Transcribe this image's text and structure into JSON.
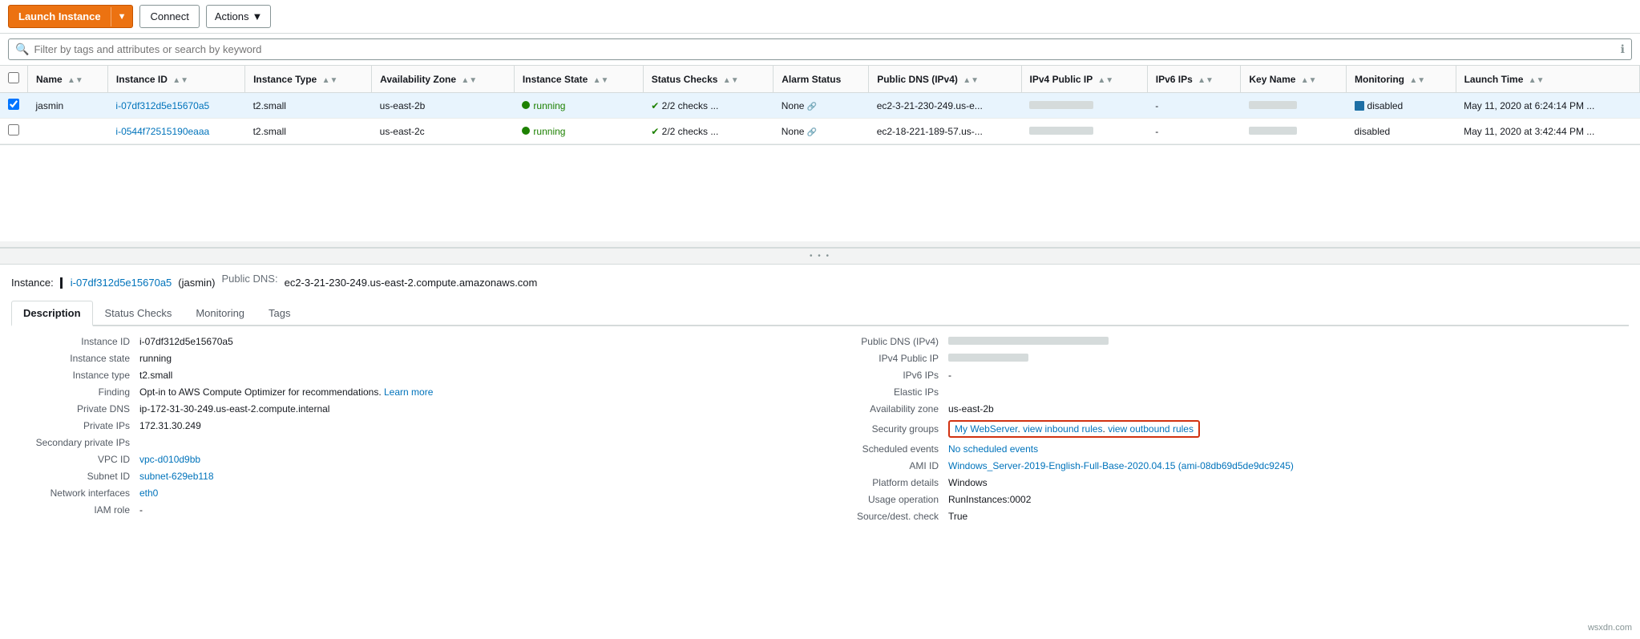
{
  "toolbar": {
    "launch_label": "Launch Instance",
    "connect_label": "Connect",
    "actions_label": "Actions"
  },
  "search": {
    "placeholder": "Filter by tags and attributes or search by keyword"
  },
  "table": {
    "columns": [
      {
        "key": "checkbox",
        "label": ""
      },
      {
        "key": "name",
        "label": "Name"
      },
      {
        "key": "instance_id",
        "label": "Instance ID"
      },
      {
        "key": "instance_type",
        "label": "Instance Type"
      },
      {
        "key": "availability_zone",
        "label": "Availability Zone"
      },
      {
        "key": "instance_state",
        "label": "Instance State"
      },
      {
        "key": "status_checks",
        "label": "Status Checks"
      },
      {
        "key": "alarm_status",
        "label": "Alarm Status"
      },
      {
        "key": "public_dns",
        "label": "Public DNS (IPv4)"
      },
      {
        "key": "ipv4_public_ip",
        "label": "IPv4 Public IP"
      },
      {
        "key": "ipv6_ips",
        "label": "IPv6 IPs"
      },
      {
        "key": "key_name",
        "label": "Key Name"
      },
      {
        "key": "monitoring",
        "label": "Monitoring"
      },
      {
        "key": "launch_time",
        "label": "Launch Time"
      }
    ],
    "rows": [
      {
        "selected": true,
        "name": "jasmin",
        "instance_id": "i-07df312d5e15670a5",
        "instance_type": "t2.small",
        "availability_zone": "us-east-2b",
        "instance_state": "running",
        "status_checks": "2/2 checks ...",
        "alarm_status": "None",
        "public_dns": "ec2-3-21-230-249.us-e...",
        "ipv4_public_ip": "blurred",
        "ipv6_ips": "-",
        "key_name": "blurred",
        "monitoring": "disabled",
        "launch_time": "May 11, 2020 at 6:24:14 PM ..."
      },
      {
        "selected": false,
        "name": "",
        "instance_id": "i-0544f72515190eaaa",
        "instance_type": "t2.small",
        "availability_zone": "us-east-2c",
        "instance_state": "running",
        "status_checks": "2/2 checks ...",
        "alarm_status": "None",
        "public_dns": "ec2-18-221-189-57.us-...",
        "ipv4_public_ip": "blurred",
        "ipv6_ips": "-",
        "key_name": "blurred",
        "monitoring": "disabled",
        "launch_time": "May 11, 2020 at 3:42:44 PM ..."
      }
    ]
  },
  "detail": {
    "instance_label": "Instance:",
    "instance_id": "i-07df312d5e15670a5",
    "instance_name": "jasmin",
    "public_dns_label": "Public DNS:",
    "public_dns": "ec2-3-21-230-249.us-east-2.compute.amazonaws.com",
    "tabs": [
      {
        "label": "Description",
        "active": true
      },
      {
        "label": "Status Checks",
        "active": false
      },
      {
        "label": "Monitoring",
        "active": false
      },
      {
        "label": "Tags",
        "active": false
      }
    ],
    "left": {
      "fields": [
        {
          "label": "Instance ID",
          "value": "i-07df312d5e15670a5",
          "type": "text"
        },
        {
          "label": "Instance state",
          "value": "running",
          "type": "text"
        },
        {
          "label": "Instance type",
          "value": "t2.small",
          "type": "text"
        },
        {
          "label": "Finding",
          "value": "Opt-in to AWS Compute Optimizer for recommendations.",
          "extra": "Learn more",
          "type": "link-extra"
        },
        {
          "label": "Private DNS",
          "value": "ip-172-31-30-249.us-east-2.compute.internal",
          "type": "text"
        },
        {
          "label": "Private IPs",
          "value": "172.31.30.249",
          "type": "text"
        },
        {
          "label": "Secondary private IPs",
          "value": "",
          "type": "text"
        },
        {
          "label": "VPC ID",
          "value": "vpc-d010d9bb",
          "type": "link"
        },
        {
          "label": "Subnet ID",
          "value": "subnet-629eb118",
          "type": "link"
        },
        {
          "label": "Network interfaces",
          "value": "eth0",
          "type": "link"
        },
        {
          "label": "IAM role",
          "value": "-",
          "type": "text"
        }
      ]
    },
    "right": {
      "fields": [
        {
          "label": "Public DNS (IPv4)",
          "value": "blurred-long",
          "type": "blurred"
        },
        {
          "label": "IPv4 Public IP",
          "value": "blurred-short",
          "type": "blurred"
        },
        {
          "label": "IPv6 IPs",
          "value": "-",
          "type": "text"
        },
        {
          "label": "Elastic IPs",
          "value": "",
          "type": "text"
        },
        {
          "label": "Availability zone",
          "value": "us-east-2b",
          "type": "text"
        },
        {
          "label": "Security groups",
          "value": "My WebServer",
          "extra_links": [
            "view inbound rules",
            "view outbound rules"
          ],
          "type": "security",
          "highlighted": true
        },
        {
          "label": "Scheduled events",
          "value": "No scheduled events",
          "type": "link"
        },
        {
          "label": "AMI ID",
          "value": "Windows_Server-2019-English-Full-Base-2020.04.15 (ami-08db69d5de9dc9245)",
          "type": "link"
        },
        {
          "label": "Platform details",
          "value": "Windows",
          "type": "text"
        },
        {
          "label": "Usage operation",
          "value": "RunInstances:0002",
          "type": "text"
        },
        {
          "label": "Source/dest. check",
          "value": "True",
          "type": "text"
        }
      ]
    }
  },
  "watermark": "wsxdn.com"
}
